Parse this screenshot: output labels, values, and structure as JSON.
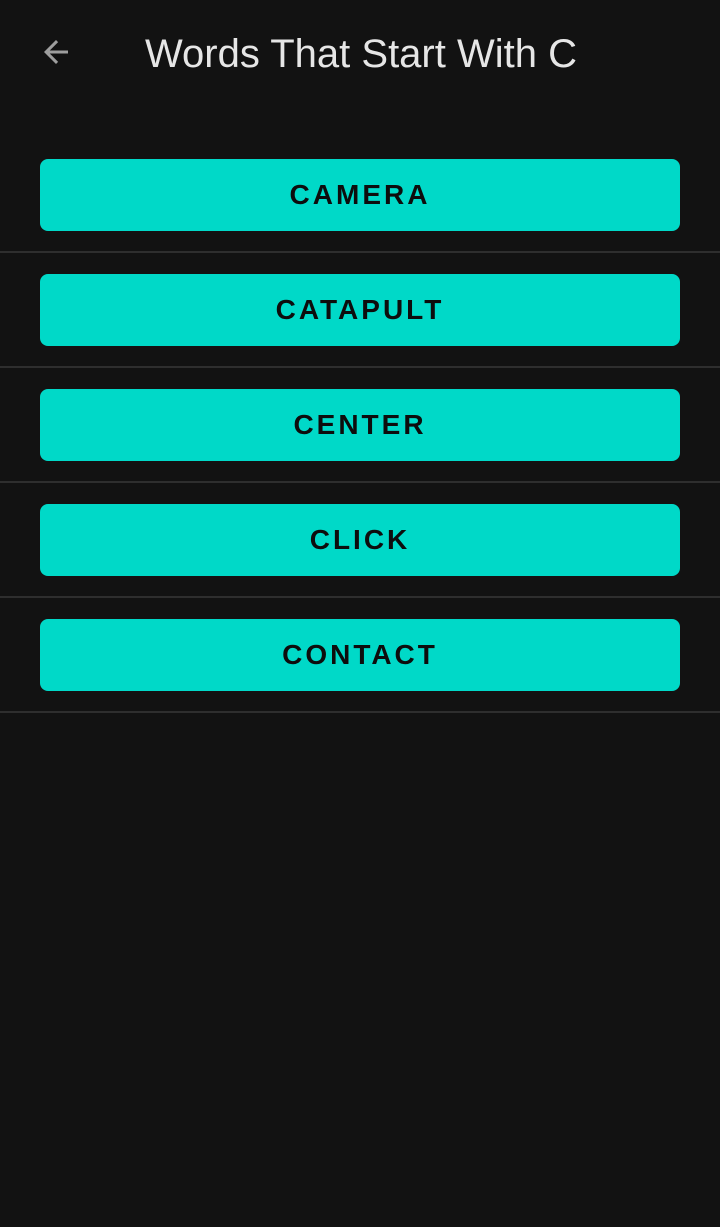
{
  "app_bar": {
    "back_icon": "arrow-left-icon",
    "title": "Words That Start With C"
  },
  "words": [
    {
      "label": "CAMERA"
    },
    {
      "label": "CATAPULT"
    },
    {
      "label": "CENTER"
    },
    {
      "label": "CLICK"
    },
    {
      "label": "CONTACT"
    }
  ],
  "colors": {
    "background": "#121212",
    "button": "#00d9c8",
    "button_text": "#0d0d0d",
    "title_text": "#e6e6e6",
    "divider": "#2e2e2e",
    "icon": "#9e9e9e"
  }
}
